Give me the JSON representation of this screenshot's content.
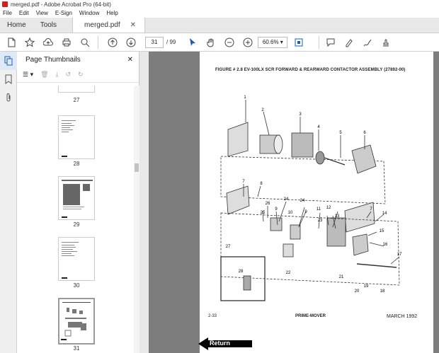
{
  "window": {
    "title": "merged.pdf - Adobe Acrobat Pro (64-bit)"
  },
  "menu": [
    "File",
    "Edit",
    "View",
    "E-Sign",
    "Window",
    "Help"
  ],
  "tabs": {
    "home": "Home",
    "tools": "Tools",
    "doc": "merged.pdf"
  },
  "toolbar": {
    "page_current": "31",
    "page_total": "/ 99",
    "zoom": "60.6%"
  },
  "panel": {
    "title": "Page Thumbnails"
  },
  "thumbnails": [
    "27",
    "28",
    "29",
    "30",
    "31"
  ],
  "document": {
    "figure_title": "FIGURE # 2.8  EV-100LX SCR FORWARD & REARWARD CONTACTOR ASSEMBLY (27892-00)",
    "footer_date": "MARCH 1992",
    "footer_logo": "PRIME-MOVER",
    "footer_page": "2-33",
    "callouts": [
      "1",
      "2",
      "3",
      "4",
      "5",
      "6",
      "7",
      "8",
      "26",
      "25",
      "24",
      "9",
      "10",
      "24",
      "9",
      "11",
      "23",
      "12",
      "13",
      "7",
      "14",
      "15",
      "16",
      "17",
      "27",
      "22",
      "21",
      "20",
      "19",
      "18",
      "28"
    ]
  },
  "return_button": {
    "label": "Return"
  }
}
